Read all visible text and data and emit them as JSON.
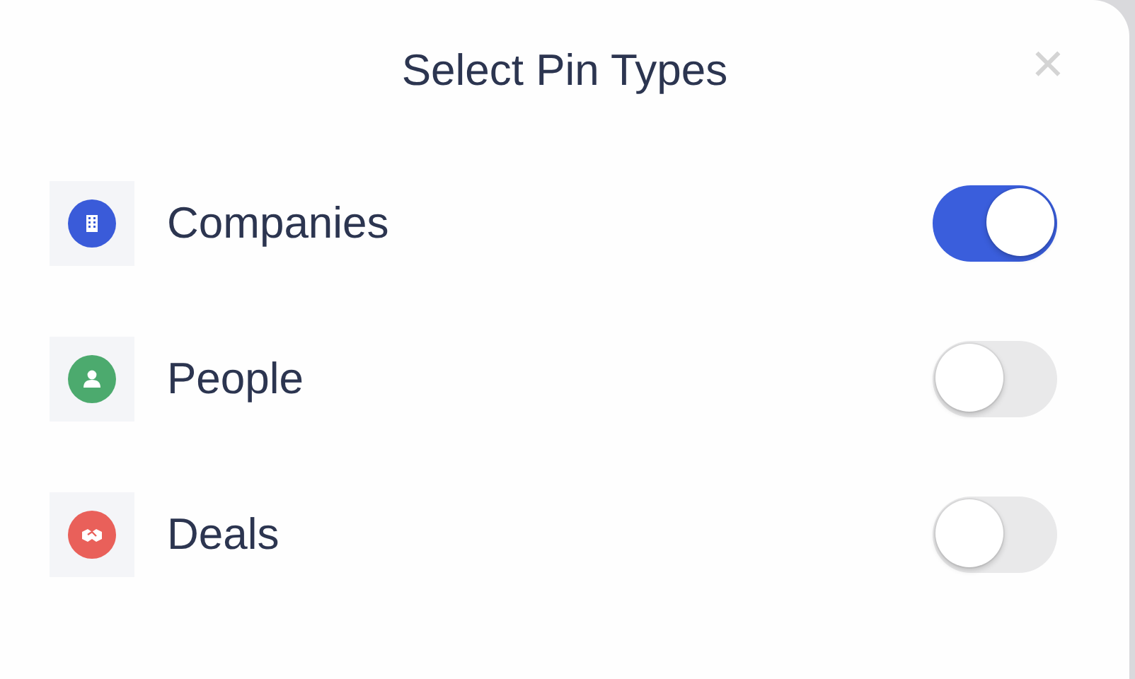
{
  "dialog": {
    "title": "Select Pin Types",
    "close": "✕"
  },
  "pin_types": [
    {
      "label": "Companies",
      "kind": "building",
      "color": "#3a5bd9",
      "on": true
    },
    {
      "label": "People",
      "kind": "person",
      "color": "#4caa6e",
      "on": false
    },
    {
      "label": "Deals",
      "kind": "handshake",
      "color": "#e9605a",
      "on": false
    }
  ]
}
